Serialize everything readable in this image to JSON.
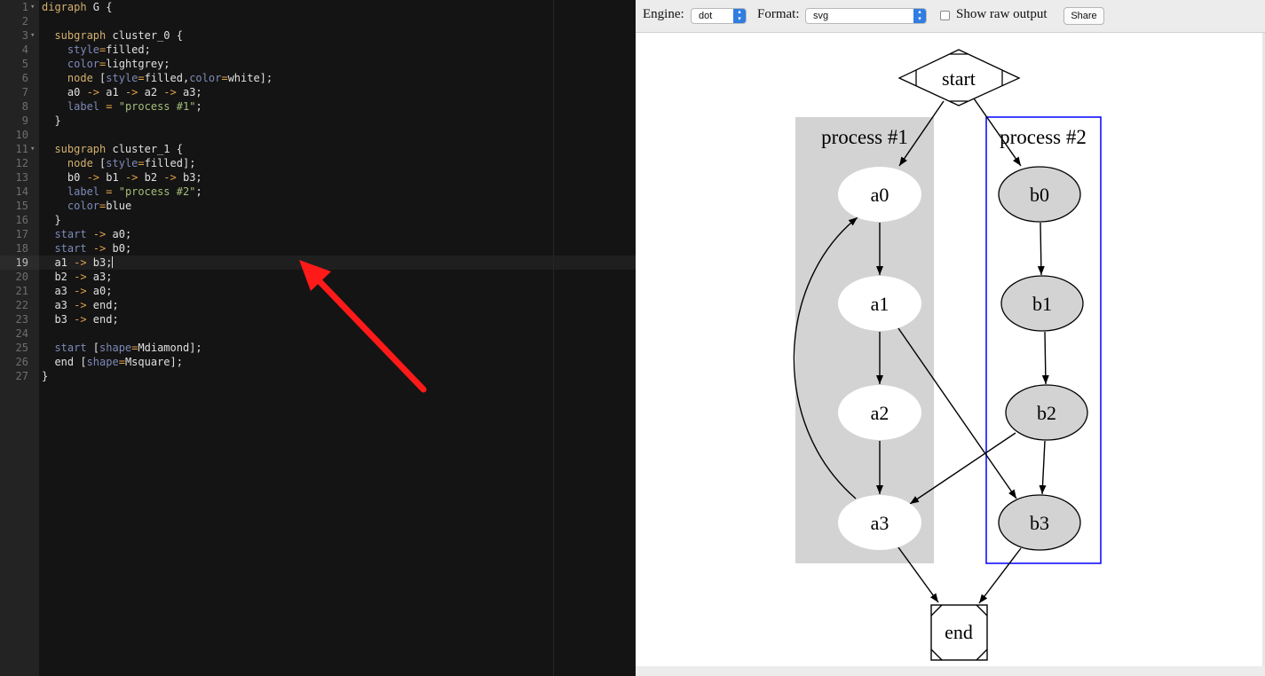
{
  "editor": {
    "line_numbers": [
      "1",
      "2",
      "3",
      "4",
      "5",
      "6",
      "7",
      "8",
      "9",
      "10",
      "11",
      "12",
      "13",
      "14",
      "15",
      "16",
      "17",
      "18",
      "19",
      "20",
      "21",
      "22",
      "23",
      "24",
      "25",
      "26",
      "27"
    ],
    "fold_marker": "▾",
    "lines": [
      [
        [
          "kw",
          "digraph "
        ],
        [
          "",
          "G {"
        ]
      ],
      [],
      [
        [
          "",
          "  "
        ],
        [
          "kw",
          "subgraph "
        ],
        [
          "",
          "cluster_0 {"
        ]
      ],
      [
        [
          "",
          "    "
        ],
        [
          "at",
          "style"
        ],
        [
          "op",
          "="
        ],
        [
          "",
          "filled;"
        ]
      ],
      [
        [
          "",
          "    "
        ],
        [
          "at",
          "color"
        ],
        [
          "op",
          "="
        ],
        [
          "",
          "lightgrey;"
        ]
      ],
      [
        [
          "",
          "    "
        ],
        [
          "kw",
          "node "
        ],
        [
          "",
          "["
        ],
        [
          "at",
          "style"
        ],
        [
          "op",
          "="
        ],
        [
          "",
          "filled,"
        ],
        [
          "at",
          "color"
        ],
        [
          "op",
          "="
        ],
        [
          "",
          "white];"
        ]
      ],
      [
        [
          "",
          "    a0 "
        ],
        [
          "op",
          "->"
        ],
        [
          "",
          " a1 "
        ],
        [
          "op",
          "->"
        ],
        [
          "",
          " a2 "
        ],
        [
          "op",
          "->"
        ],
        [
          "",
          " a3;"
        ]
      ],
      [
        [
          "",
          "    "
        ],
        [
          "at",
          "label"
        ],
        [
          "",
          " "
        ],
        [
          "op",
          "="
        ],
        [
          "",
          " "
        ],
        [
          "str",
          "\"process #1\""
        ],
        [
          "",
          ";"
        ]
      ],
      [
        [
          "",
          "  }"
        ]
      ],
      [],
      [
        [
          "",
          "  "
        ],
        [
          "kw",
          "subgraph "
        ],
        [
          "",
          "cluster_1 {"
        ]
      ],
      [
        [
          "",
          "    "
        ],
        [
          "kw",
          "node "
        ],
        [
          "",
          "["
        ],
        [
          "at",
          "style"
        ],
        [
          "op",
          "="
        ],
        [
          "",
          "filled];"
        ]
      ],
      [
        [
          "",
          "    b0 "
        ],
        [
          "op",
          "->"
        ],
        [
          "",
          " b1 "
        ],
        [
          "op",
          "->"
        ],
        [
          "",
          " b2 "
        ],
        [
          "op",
          "->"
        ],
        [
          "",
          " b3;"
        ]
      ],
      [
        [
          "",
          "    "
        ],
        [
          "at",
          "label"
        ],
        [
          "",
          " "
        ],
        [
          "op",
          "="
        ],
        [
          "",
          " "
        ],
        [
          "str",
          "\"process #2\""
        ],
        [
          "",
          ";"
        ]
      ],
      [
        [
          "",
          "    "
        ],
        [
          "at",
          "color"
        ],
        [
          "op",
          "="
        ],
        [
          "",
          "blue"
        ]
      ],
      [
        [
          "",
          "  }"
        ]
      ],
      [
        [
          "",
          "  "
        ],
        [
          "at",
          "start"
        ],
        [
          "",
          " "
        ],
        [
          "op",
          "->"
        ],
        [
          "",
          " a0;"
        ]
      ],
      [
        [
          "",
          "  "
        ],
        [
          "at",
          "start"
        ],
        [
          "",
          " "
        ],
        [
          "op",
          "->"
        ],
        [
          "",
          " b0;"
        ]
      ],
      [
        [
          "",
          "  a1 "
        ],
        [
          "op",
          "->"
        ],
        [
          "",
          " b3;"
        ]
      ],
      [
        [
          "",
          "  b2 "
        ],
        [
          "op",
          "->"
        ],
        [
          "",
          " a3;"
        ]
      ],
      [
        [
          "",
          "  a3 "
        ],
        [
          "op",
          "->"
        ],
        [
          "",
          " a0;"
        ]
      ],
      [
        [
          "",
          "  a3 "
        ],
        [
          "op",
          "->"
        ],
        [
          "",
          " end;"
        ]
      ],
      [
        [
          "",
          "  b3 "
        ],
        [
          "op",
          "->"
        ],
        [
          "",
          " end;"
        ]
      ],
      [],
      [
        [
          "",
          "  "
        ],
        [
          "at",
          "start"
        ],
        [
          "",
          " ["
        ],
        [
          "at",
          "shape"
        ],
        [
          "op",
          "="
        ],
        [
          "",
          "Mdiamond];"
        ]
      ],
      [
        [
          "",
          "  end ["
        ],
        [
          "at",
          "shape"
        ],
        [
          "op",
          "="
        ],
        [
          "",
          "Msquare];"
        ]
      ],
      [
        [
          "",
          "}"
        ]
      ]
    ]
  },
  "toolbar": {
    "engine_label": "Engine:",
    "engine_value": "dot",
    "format_label": "Format:",
    "format_value": "svg",
    "raw_output_label": "Show raw output",
    "raw_output_checked": false,
    "share_label": "Share"
  },
  "graph": {
    "clusters": {
      "c0": {
        "label": "process #1",
        "fill": "#d3d3d3"
      },
      "c1": {
        "label": "process #2",
        "stroke": "#0000ff"
      }
    },
    "nodes": {
      "start": "start",
      "end": "end",
      "a0": "a0",
      "a1": "a1",
      "a2": "a2",
      "a3": "a3",
      "b0": "b0",
      "b1": "b1",
      "b2": "b2",
      "b3": "b3"
    },
    "node_fill_b": "#d3d3d3"
  },
  "annotation": {
    "arrow_color": "#ff1a1a"
  }
}
